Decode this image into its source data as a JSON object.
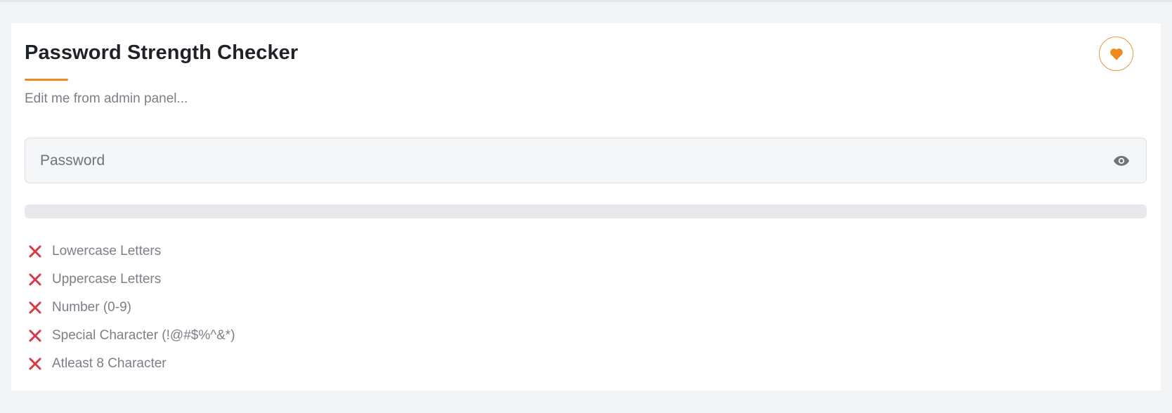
{
  "header": {
    "title": "Password Strength Checker",
    "subtitle": "Edit me from admin panel..."
  },
  "password": {
    "placeholder": "Password",
    "value": ""
  },
  "strength": {
    "fraction": 0
  },
  "criteria": [
    {
      "label": "Lowercase Letters",
      "met": false
    },
    {
      "label": "Uppercase Letters",
      "met": false
    },
    {
      "label": "Number (0-9)",
      "met": false
    },
    {
      "label": "Special Character (!@#$%^&*)",
      "met": false
    },
    {
      "label": "Atleast 8 Character",
      "met": false
    }
  ],
  "colors": {
    "accent": "#ee8a1f",
    "fail": "#dc3545",
    "text_muted": "#7b8088"
  },
  "icons": {
    "favorite": "heart-icon",
    "visibility": "eye-icon",
    "unmet": "x-icon"
  }
}
